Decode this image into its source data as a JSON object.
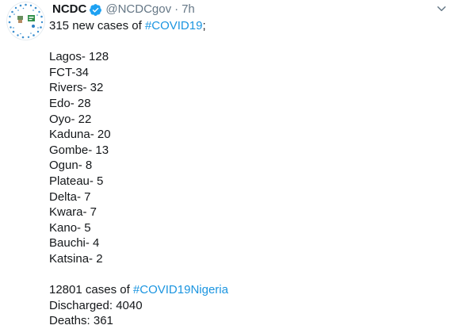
{
  "tweet": {
    "display_name": "NCDC",
    "handle": "@NCDCgov",
    "separator": "·",
    "time": "7h",
    "intro_prefix": "315 new cases of ",
    "intro_hashtag": "#COVID19",
    "intro_suffix": ";",
    "states": [
      "Lagos- 128",
      "FCT-34",
      "Rivers- 32",
      "Edo- 28",
      "Oyo- 22",
      "Kaduna- 20",
      "Gombe- 13",
      "Ogun- 8",
      "Plateau- 5",
      "Delta- 7",
      "Kwara- 7",
      "Kano- 5",
      "Bauchi- 4",
      "Katsina- 2"
    ],
    "total_prefix": "12801 cases of ",
    "total_hashtag": "#COVID19Nigeria",
    "discharged": "Discharged: 4040",
    "deaths": "Deaths: 361"
  },
  "icons": {
    "avatar": "ncdc-logo-icon",
    "verified": "verified-badge-icon",
    "menu": "chevron-down-icon"
  },
  "colors": {
    "text": "#14171a",
    "secondary": "#657786",
    "link": "#1b95e0",
    "verified": "#1da1f2"
  }
}
